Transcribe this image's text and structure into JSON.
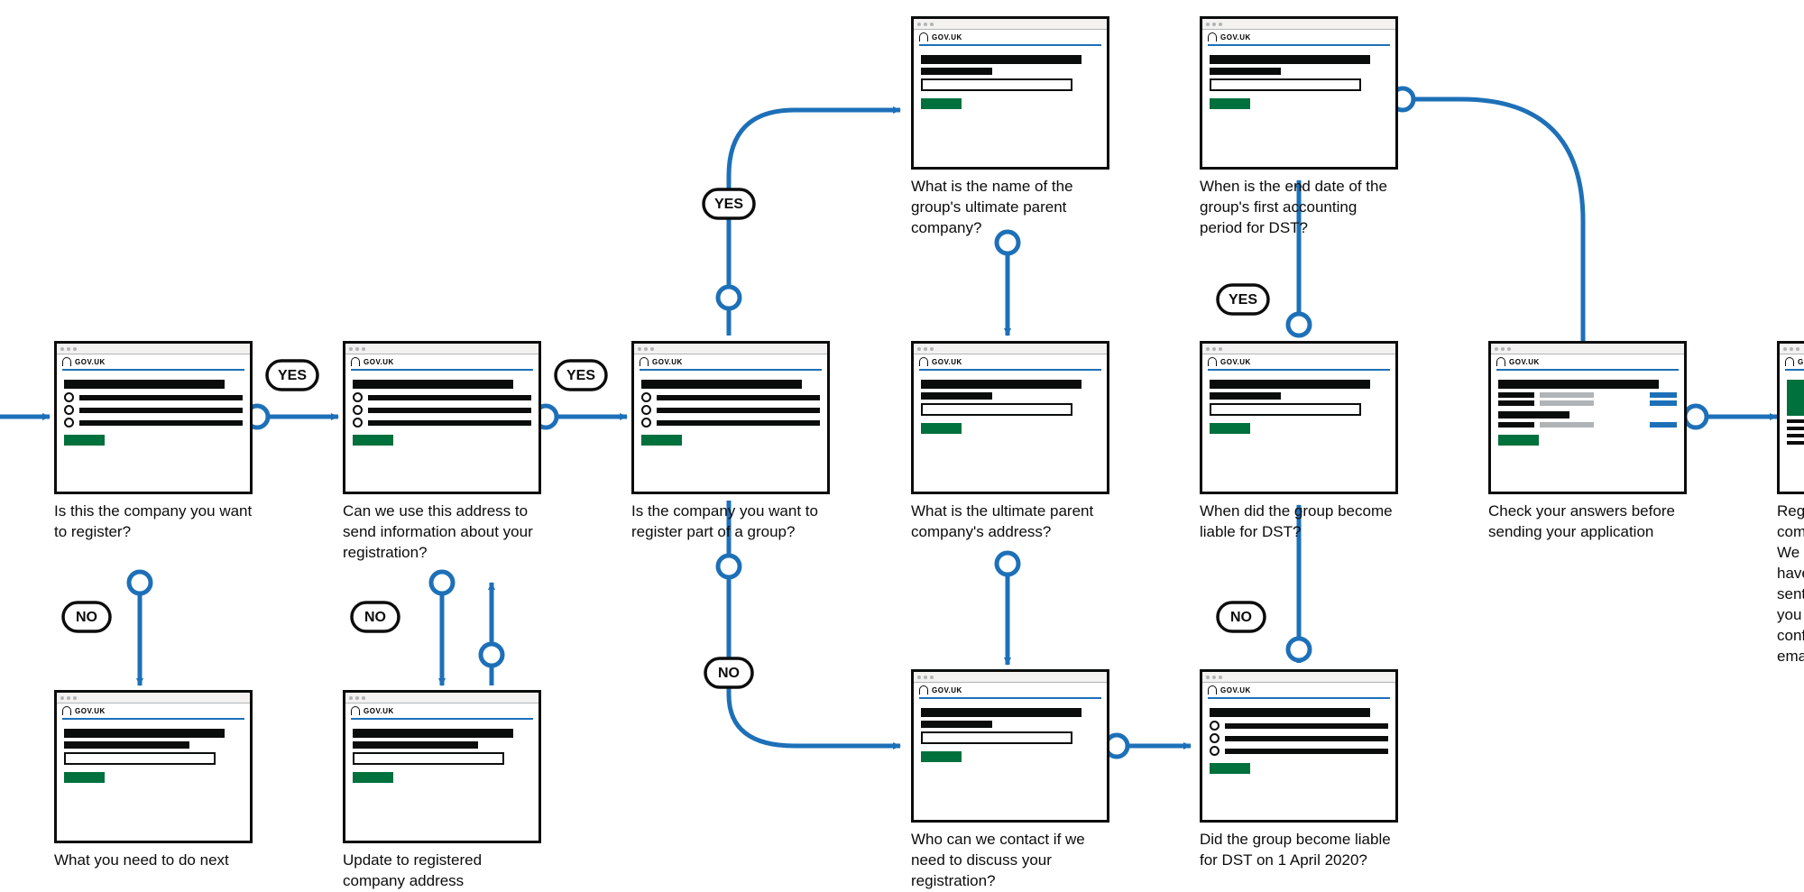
{
  "brand": "GOV.UK",
  "labels": {
    "yes": "YES",
    "no": "NO"
  },
  "nodes": {
    "n1": {
      "caption": "Is this the company you want to register?"
    },
    "n1b": {
      "caption": "What you need to do next"
    },
    "n2": {
      "caption": "Can we use this address to send information about your registration?"
    },
    "n2b": {
      "caption": "Update to registered company address"
    },
    "n3": {
      "caption": "Is the company you want to register part of a group?"
    },
    "n4": {
      "caption": "What is the name of the group's ultimate parent company?"
    },
    "n5": {
      "caption": "What is the ultimate parent company's address?"
    },
    "n6": {
      "caption": "Who can we contact if we need to discuss your registration?"
    },
    "n7": {
      "caption": "When is the end date of the group's first accounting period for DST?"
    },
    "n8": {
      "caption": "When did the group become liable for DST?"
    },
    "n9": {
      "caption": "Did the group become liable for DST on 1 April 2020?"
    },
    "n10": {
      "caption": "Check your answers before sending your application"
    },
    "n11": {
      "caption": "Registration complete. We have sent you a confirmation email."
    }
  }
}
